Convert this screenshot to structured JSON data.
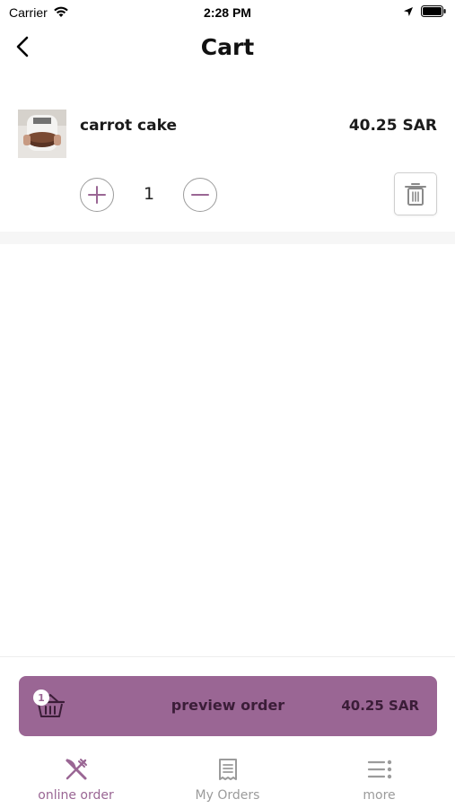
{
  "status_bar": {
    "carrier": "Carrier",
    "time": "2:28 PM"
  },
  "header": {
    "title": "Cart"
  },
  "cart": {
    "items": [
      {
        "name": "carrot cake",
        "price": "40.25 SAR",
        "quantity": "1"
      }
    ]
  },
  "preview_order": {
    "label": "preview order",
    "total": "40.25 SAR",
    "badge_count": "1"
  },
  "tab_bar": {
    "tabs": [
      {
        "label": "online order",
        "icon": "fork-knife-icon",
        "active": true
      },
      {
        "label": "My Orders",
        "icon": "receipt-icon",
        "active": false
      },
      {
        "label": "more",
        "icon": "menu-icon",
        "active": false
      }
    ]
  },
  "colors": {
    "accent": "#9a6694",
    "accent_text": "#3b1d38",
    "inactive_tab": "#9b9b9b"
  }
}
